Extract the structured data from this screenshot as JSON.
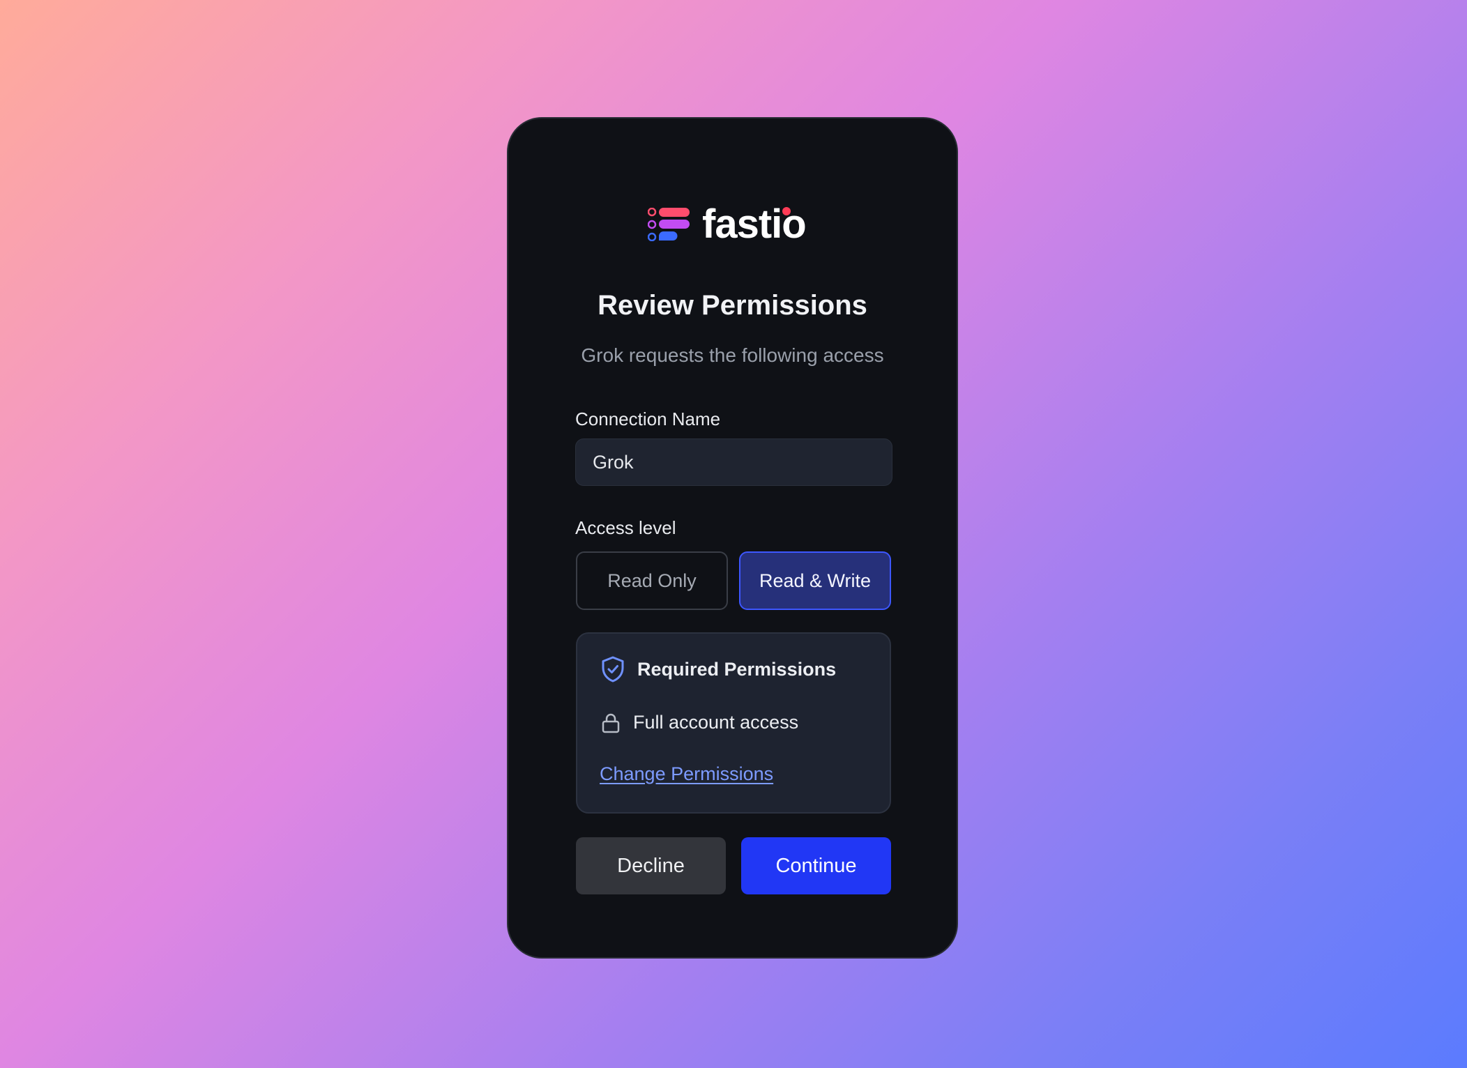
{
  "logo": {
    "text": "fastio"
  },
  "header": {
    "title": "Review Permissions",
    "subtitle": "Grok requests the following access"
  },
  "connection": {
    "label": "Connection Name",
    "value": "Grok"
  },
  "access": {
    "label": "Access level",
    "options": [
      {
        "label": "Read Only",
        "selected": false
      },
      {
        "label": "Read & Write",
        "selected": true
      }
    ]
  },
  "permissions": {
    "heading": "Required Permissions",
    "items": [
      {
        "label": "Full account access",
        "icon": "lock-icon"
      }
    ],
    "change_link": "Change Permissions",
    "heading_icon": "shield-check-icon"
  },
  "actions": {
    "decline": "Decline",
    "continue": "Continue"
  },
  "colors": {
    "accent": "#2137f5",
    "selected_bg": "#26307a",
    "link": "#7d9bff",
    "card_bg": "#0f1116"
  }
}
